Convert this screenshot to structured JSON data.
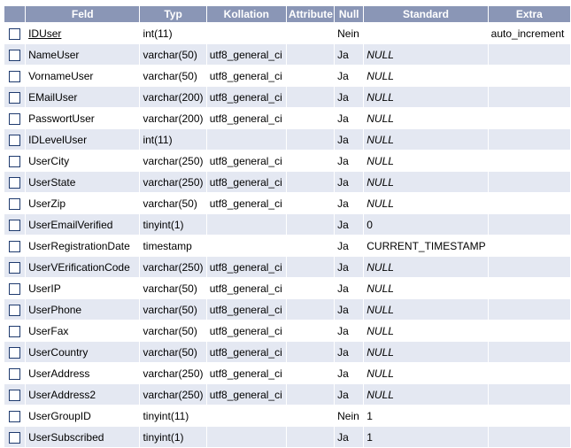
{
  "header": {
    "field": "Feld",
    "type": "Typ",
    "collation": "Kollation",
    "attribute": "Attribute",
    "null": "Null",
    "default": "Standard",
    "extra": "Extra"
  },
  "rows": [
    {
      "field": "IDUser",
      "type": "int(11)",
      "collation": "",
      "attribute": "",
      "null": "Nein",
      "default": "",
      "extra": "auto_increment"
    },
    {
      "field": "NameUser",
      "type": "varchar(50)",
      "collation": "utf8_general_ci",
      "attribute": "",
      "null": "Ja",
      "default": "NULL",
      "extra": ""
    },
    {
      "field": "VornameUser",
      "type": "varchar(50)",
      "collation": "utf8_general_ci",
      "attribute": "",
      "null": "Ja",
      "default": "NULL",
      "extra": ""
    },
    {
      "field": "EMailUser",
      "type": "varchar(200)",
      "collation": "utf8_general_ci",
      "attribute": "",
      "null": "Ja",
      "default": "NULL",
      "extra": ""
    },
    {
      "field": "PasswortUser",
      "type": "varchar(200)",
      "collation": "utf8_general_ci",
      "attribute": "",
      "null": "Ja",
      "default": "NULL",
      "extra": ""
    },
    {
      "field": "IDLevelUser",
      "type": "int(11)",
      "collation": "",
      "attribute": "",
      "null": "Ja",
      "default": "NULL",
      "extra": ""
    },
    {
      "field": "UserCity",
      "type": "varchar(250)",
      "collation": "utf8_general_ci",
      "attribute": "",
      "null": "Ja",
      "default": "NULL",
      "extra": ""
    },
    {
      "field": "UserState",
      "type": "varchar(250)",
      "collation": "utf8_general_ci",
      "attribute": "",
      "null": "Ja",
      "default": "NULL",
      "extra": ""
    },
    {
      "field": "UserZip",
      "type": "varchar(50)",
      "collation": "utf8_general_ci",
      "attribute": "",
      "null": "Ja",
      "default": "NULL",
      "extra": ""
    },
    {
      "field": "UserEmailVerified",
      "type": "tinyint(1)",
      "collation": "",
      "attribute": "",
      "null": "Ja",
      "default": "0",
      "extra": ""
    },
    {
      "field": "UserRegistrationDate",
      "type": "timestamp",
      "collation": "",
      "attribute": "",
      "null": "Ja",
      "default": "CURRENT_TIMESTAMP",
      "extra": ""
    },
    {
      "field": "UserVErificationCode",
      "type": "varchar(250)",
      "collation": "utf8_general_ci",
      "attribute": "",
      "null": "Ja",
      "default": "NULL",
      "extra": ""
    },
    {
      "field": "UserIP",
      "type": "varchar(50)",
      "collation": "utf8_general_ci",
      "attribute": "",
      "null": "Ja",
      "default": "NULL",
      "extra": ""
    },
    {
      "field": "UserPhone",
      "type": "varchar(50)",
      "collation": "utf8_general_ci",
      "attribute": "",
      "null": "Ja",
      "default": "NULL",
      "extra": ""
    },
    {
      "field": "UserFax",
      "type": "varchar(50)",
      "collation": "utf8_general_ci",
      "attribute": "",
      "null": "Ja",
      "default": "NULL",
      "extra": ""
    },
    {
      "field": "UserCountry",
      "type": "varchar(50)",
      "collation": "utf8_general_ci",
      "attribute": "",
      "null": "Ja",
      "default": "NULL",
      "extra": ""
    },
    {
      "field": "UserAddress",
      "type": "varchar(250)",
      "collation": "utf8_general_ci",
      "attribute": "",
      "null": "Ja",
      "default": "NULL",
      "extra": ""
    },
    {
      "field": "UserAddress2",
      "type": "varchar(250)",
      "collation": "utf8_general_ci",
      "attribute": "",
      "null": "Ja",
      "default": "NULL",
      "extra": ""
    },
    {
      "field": "UserGroupID",
      "type": "tinyint(11)",
      "collation": "",
      "attribute": "",
      "null": "Nein",
      "default": "1",
      "extra": ""
    },
    {
      "field": "UserSubscribed",
      "type": "tinyint(1)",
      "collation": "",
      "attribute": "",
      "null": "Ja",
      "default": "1",
      "extra": ""
    }
  ],
  "colors": {
    "header_bg": "#8a96b6",
    "row_alt_bg": "#e4e8f2",
    "checkbox_border": "#1e3a6e"
  }
}
